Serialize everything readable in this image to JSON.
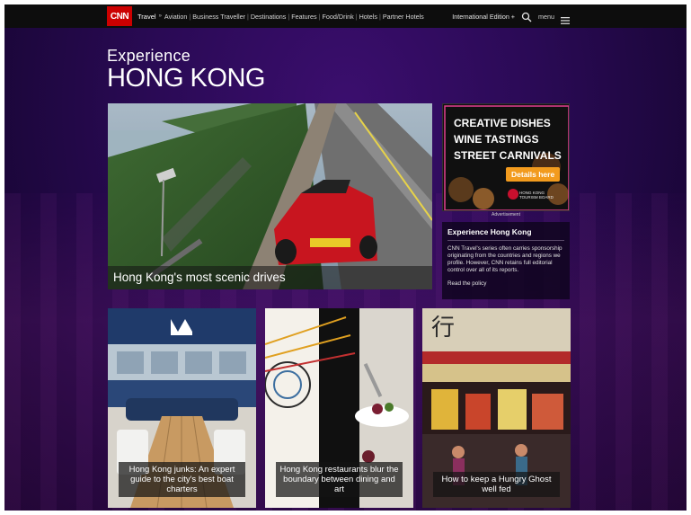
{
  "topbar": {
    "logo": "CNN",
    "section": "Travel",
    "links": [
      "Aviation",
      "Business Traveller",
      "Destinations",
      "Features",
      "Food/Drink",
      "Hotels",
      "Partner Hotels"
    ],
    "edition": "International Edition +",
    "menu": "menu"
  },
  "heading": {
    "small": "Experience",
    "big": "HONG KONG"
  },
  "hero": {
    "caption": "Hong Kong's most scenic drives"
  },
  "ad": {
    "line1": "CREATIVE DISHES",
    "line2": "WINE TASTINGS",
    "line3": "STREET CARNIVALS",
    "cta": "Details here",
    "brand": "HONG KONG TOURISM BOARD",
    "label": "Advertisement"
  },
  "sponsor": {
    "title": "Experience Hong Kong",
    "body": "CNN Travel's series often carries sponsorship originating from the countries and regions we profile. However, CNN retains full editorial control over all of its reports.",
    "link": "Read the policy"
  },
  "cards": [
    {
      "caption": "Hong Kong junks: An expert guide to the city's best boat charters"
    },
    {
      "caption": "Hong Kong restaurants blur the boundary between dining and art"
    },
    {
      "caption": "How to keep a Hungry Ghost well fed"
    }
  ],
  "colors": {
    "cnn_red": "#cc0000",
    "background_purple": "#2a0a55",
    "ad_cta": "#f29b1e"
  }
}
